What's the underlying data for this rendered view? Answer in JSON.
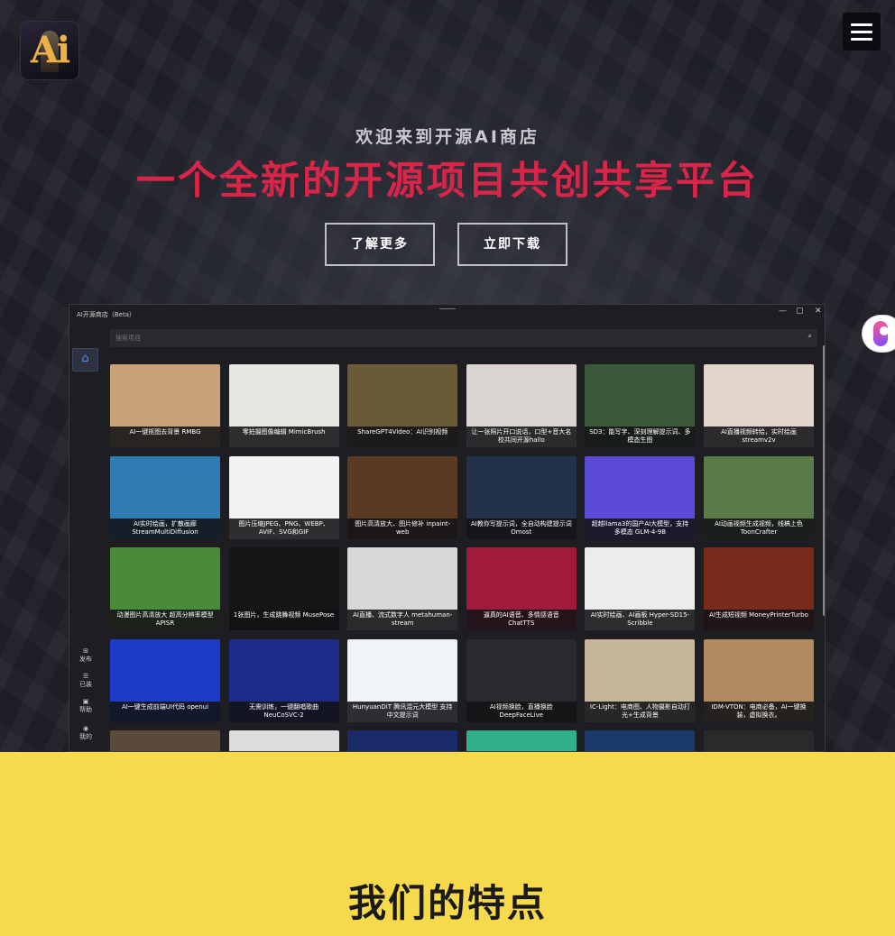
{
  "header": {
    "logo_text": "Ai",
    "menu_icon": "hamburger-menu-icon"
  },
  "hero": {
    "welcome": "欢迎来到开源AI商店",
    "slogan": "一个全新的开源项目共创共享平台",
    "learn_more": "了解更多",
    "download": "立即下载",
    "accent": "#d9254a"
  },
  "app": {
    "title": "AI开源商店（Beta）",
    "controls": [
      "—",
      "▢",
      "✕"
    ],
    "search_placeholder": "搜索项目",
    "sidebar": [
      {
        "icon": "publish-icon",
        "label": "发布"
      },
      {
        "icon": "installed-icon",
        "label": "已装"
      },
      {
        "icon": "help-icon",
        "label": "帮助"
      },
      {
        "icon": "profile-icon",
        "label": "我的"
      }
    ],
    "cards": [
      {
        "caption": "AI一键抠图去背景 RMBG",
        "bg": "#c9a27a"
      },
      {
        "caption": "零拍摄图像编辑 MimicBrush",
        "bg": "#e8e6e1"
      },
      {
        "caption": "ShareGPT4Video：AI识别视频",
        "bg": "#6a5a3a"
      },
      {
        "caption": "让一张照片开口说话，口型+音大名校共同开源hallo",
        "bg": "#d9d4cf"
      },
      {
        "caption": "SD3：能写字、深刻理解提示词、多模态生图",
        "bg": "#3a5a3a"
      },
      {
        "caption": "AI直播视频转绘，实时绘画 streamv2v",
        "bg": "#e2d6cc"
      },
      {
        "caption": "AI实时绘画，扩散画廊 StreamMultiDiffusion",
        "bg": "#2f7cb2"
      },
      {
        "caption": "图片压缩JPEG、PNG、WEBP、AVIF、SVG和GIF",
        "bg": "#f2f2f2"
      },
      {
        "caption": "图片高清放大、图片修补 inpaint-web",
        "bg": "#5a3a20"
      },
      {
        "caption": "AI教你写提示词，全自动构建提示词 Omost",
        "bg": "#23324a"
      },
      {
        "caption": "超越llama3的国产AI大模型，支持多模态 GLM-4-9B",
        "bg": "#5a4ad6"
      },
      {
        "caption": "AI动画视频生成视频，线稿上色 ToonCrafter",
        "bg": "#5a7a4a"
      },
      {
        "caption": "动漫图片高清放大 超高分辨率模型 APISR",
        "bg": "#4a8a3a"
      },
      {
        "caption": "1张图片，生成跳舞视频 MusePose",
        "bg": "#151515"
      },
      {
        "caption": "AI直播、流式数字人 metahuman-stream",
        "bg": "#d8d8d8"
      },
      {
        "caption": "逼真的AI语音、多情感语音 ChatTTS",
        "bg": "#a01a3a"
      },
      {
        "caption": "AI实时绘画、AI画板 Hyper-SD15-Scribble",
        "bg": "#ececec"
      },
      {
        "caption": "AI生成短视频 MoneyPrinterTurbo",
        "bg": "#7a2a1a"
      },
      {
        "caption": "AI一键生成前端UI代码 openui",
        "bg": "#1a3cc8"
      },
      {
        "caption": "无需训练，一键翻唱歌曲 NeuCoSVC-2",
        "bg": "#1e2a8a"
      },
      {
        "caption": "HunyuanDiT 腾讯混元大模型 支持中文提示词",
        "bg": "#f0f4f8"
      },
      {
        "caption": "AI视频换脸，直播换脸 DeepFaceLive",
        "bg": "#2a2a2e"
      },
      {
        "caption": "IC-Light：电商图、人物摄影自动打光+生成背景",
        "bg": "#c7b59a"
      },
      {
        "caption": "IDM-VTON：电商必备，AI一键换装，虚拟换衣。",
        "bg": "#b08a60"
      },
      {
        "caption": "",
        "bg": "#5a4a3a"
      },
      {
        "caption": "",
        "bg": "#dcdcdc"
      },
      {
        "caption": "",
        "bg": "#1a2a6a"
      },
      {
        "caption": "",
        "bg": "#2fb08a"
      },
      {
        "caption": "",
        "bg": "#1a3a6a"
      },
      {
        "caption": "",
        "bg": "#2a2a2a"
      }
    ]
  },
  "features": {
    "title": "我们的特点"
  },
  "colors": {
    "yellow": "#f7d94c",
    "dark": "#1b1c24"
  }
}
